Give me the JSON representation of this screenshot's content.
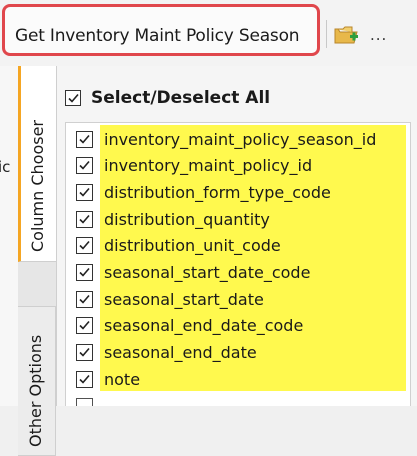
{
  "toolbar": {
    "title": "Get Inventory Maint Policy Season",
    "more_label": "...",
    "folder_icon": "folder-add-icon"
  },
  "left_stub": {
    "text": "ic"
  },
  "tabs": [
    {
      "label": "Column Chooser",
      "active": true
    },
    {
      "label": "Other Options",
      "active": false
    }
  ],
  "main": {
    "select_all_label": "Select/Deselect All",
    "select_all_checked": true,
    "highlight_color": "#fff94e",
    "items": [
      {
        "label": "inventory_maint_policy_season_id",
        "checked": true
      },
      {
        "label": "inventory_maint_policy_id",
        "checked": true
      },
      {
        "label": "distribution_form_type_code",
        "checked": true
      },
      {
        "label": "distribution_quantity",
        "checked": true
      },
      {
        "label": "distribution_unit_code",
        "checked": true
      },
      {
        "label": "seasonal_start_date_code",
        "checked": true
      },
      {
        "label": "seasonal_start_date",
        "checked": true
      },
      {
        "label": "seasonal_end_date_code",
        "checked": true
      },
      {
        "label": "seasonal_end_date",
        "checked": true
      },
      {
        "label": "note",
        "checked": true
      }
    ]
  },
  "colors": {
    "title_highlight_border": "#e0474c",
    "active_tab_accent": "#f5a623"
  }
}
